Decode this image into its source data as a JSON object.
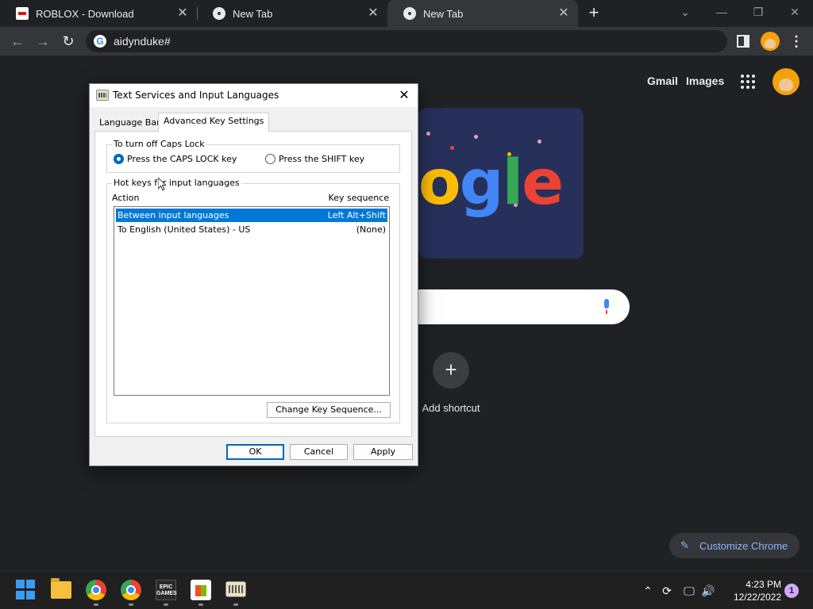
{
  "browser": {
    "tabs": [
      {
        "label": "ROBLOX - Download"
      },
      {
        "label": "New Tab"
      },
      {
        "label": "New Tab"
      }
    ],
    "address": "aidynduke#"
  },
  "ntp": {
    "gmail": "Gmail",
    "images": "Images",
    "add_shortcut": "Add shortcut",
    "customize": "Customize Chrome",
    "doodle_text": "ogle"
  },
  "dialog": {
    "title": "Text Services and Input Languages",
    "tabs": [
      "Language Bar",
      "Advanced Key Settings"
    ],
    "caps_group": "To turn off Caps Lock",
    "radio_caps": "Press the CAPS LOCK key",
    "radio_shift": "Press the SHIFT key",
    "hotkeys_group": "Hot keys for input languages",
    "col_action": "Action",
    "col_key": "Key sequence",
    "rows": [
      {
        "action": "Between input languages",
        "key": "Left Alt+Shift"
      },
      {
        "action": "To English (United States) - US",
        "key": "(None)"
      }
    ],
    "change_btn": "Change Key Sequence...",
    "ok": "OK",
    "cancel": "Cancel",
    "apply": "Apply"
  },
  "taskbar": {
    "epic_label": "EPIC GAMES",
    "time": "4:23 PM",
    "date": "12/22/2022",
    "notifications": "1"
  },
  "colors": {
    "selection": "#0078d7",
    "accent": "#0067c0",
    "chrome_bg": "#202124",
    "customize_text": "#8ab4f8"
  }
}
